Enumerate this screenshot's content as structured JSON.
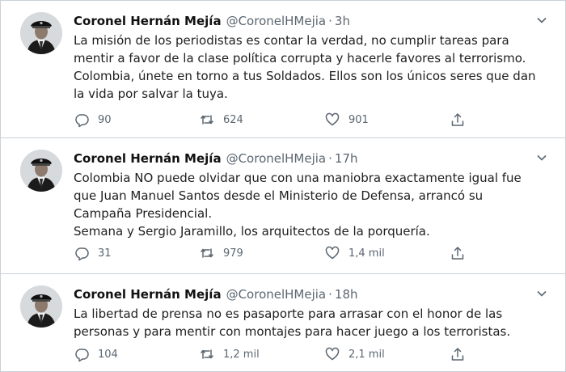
{
  "account": {
    "name": "Coronel Hernán Mejía",
    "handle": "@CoronelHMejia",
    "separator": "·"
  },
  "icons": {
    "reply": "reply-bubble-icon",
    "retweet": "retweet-icon",
    "like": "heart-icon",
    "share": "share-upload-icon",
    "more": "chevron-down-icon"
  },
  "colors": {
    "text": "#1e1e1e",
    "secondary": "#5b6670",
    "divider": "#c9d1d8"
  },
  "tweets": [
    {
      "time": "3h",
      "text": "La misión de los periodistas es contar la verdad, no cumplir tareas para\nmentir a favor de la clase política corrupta y hacerle favores al terrorismo.\nColombia, únete en torno a tus Soldados. Ellos son los únicos seres que dan\nla vida por salvar la tuya.",
      "replies": "90",
      "retweets": "624",
      "likes": "901"
    },
    {
      "time": "17h",
      "text": "Colombia NO puede olvidar que con una maniobra exactamente igual fue\nque Juan Manuel Santos desde el Ministerio de Defensa, arrancó su\nCampaña Presidencial.\nSemana y Sergio Jaramillo, los arquitectos de la porquería.",
      "replies": "31",
      "retweets": "979",
      "likes": "1,4 mil"
    },
    {
      "time": "18h",
      "text": "La libertad de prensa no es pasaporte para arrasar con el honor de las\npersonas y para mentir con montajes para hacer juego a los terroristas.",
      "replies": "104",
      "retweets": "1,2 mil",
      "likes": "2,1 mil"
    }
  ]
}
